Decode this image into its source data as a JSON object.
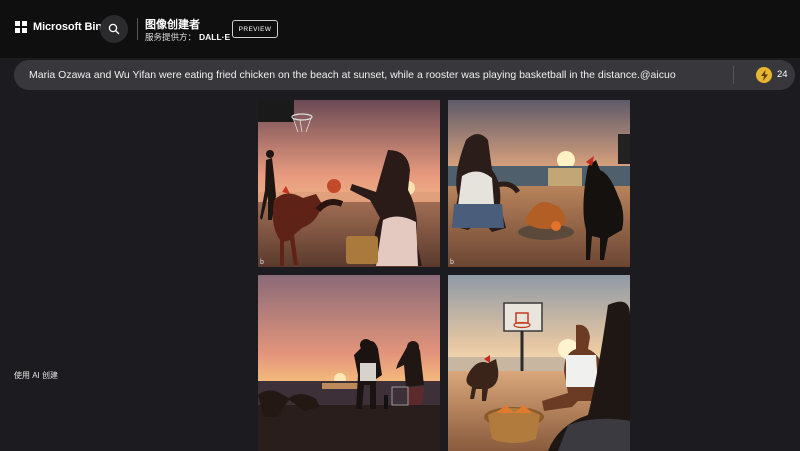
{
  "header": {
    "brand": "Microsoft Bing",
    "app_title": "图像创建者",
    "provider_label": "服务提供方：",
    "provider_name": "DALL·E",
    "preview_badge": "PREVIEW"
  },
  "prompt": {
    "text": "Maria Ozawa and Wu Yifan were eating fried chicken on the beach at sunset, while a rooster was playing basketball in the distance.@aicuo",
    "boosts_count": "24"
  },
  "sidebar": {
    "created_with_ai": "使用 AI 创建"
  },
  "images": [
    {
      "badge": "b"
    },
    {
      "badge": "b"
    },
    {
      "badge": ""
    },
    {
      "badge": ""
    }
  ],
  "colors": {
    "topbar": "#0f0f10",
    "prompt_bar": "#38383c",
    "boost": "#e8b530",
    "page_bg": "#1c1b1f"
  },
  "icons": [
    "microsoft-logo-icon",
    "search-icon",
    "lightning-boost-icon"
  ]
}
